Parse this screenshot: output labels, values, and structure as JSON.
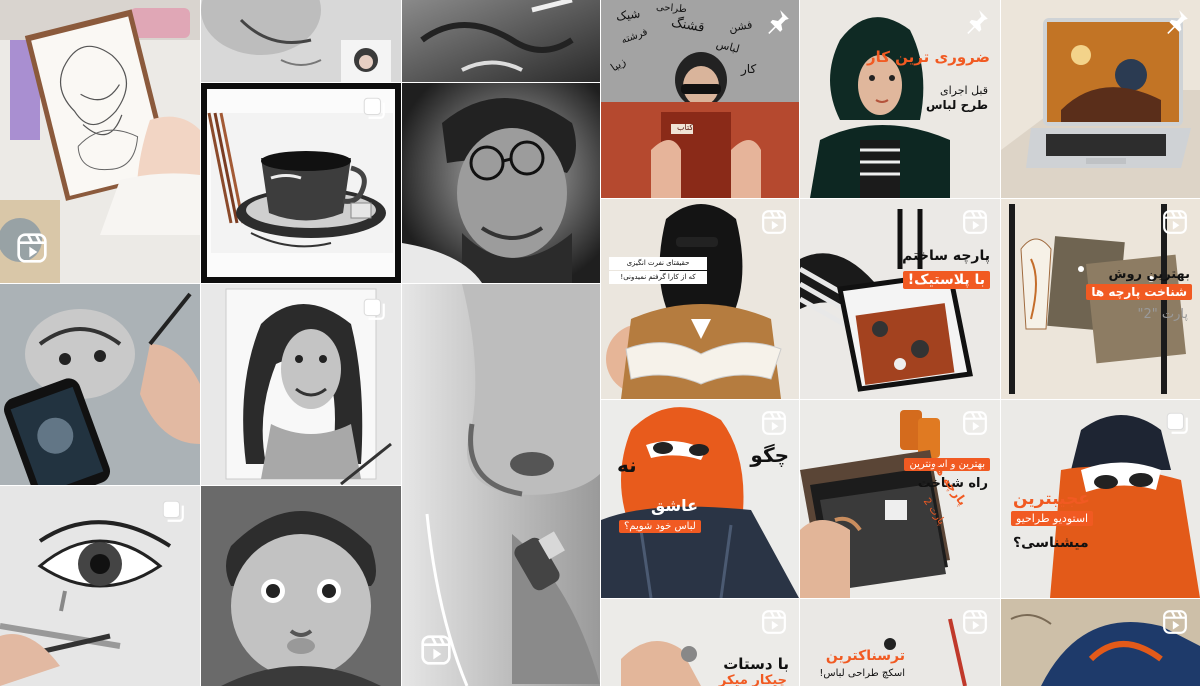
{
  "grid": {
    "tiles": [
      {
        "id": "sketching-desk",
        "type": "reel"
      },
      {
        "id": "woman-portrait-pencil",
        "type": "photo"
      },
      {
        "id": "old-man-pencil",
        "type": "photo"
      },
      {
        "id": "coffee-cup-drawing",
        "type": "carousel"
      },
      {
        "id": "man-glasses-drawing",
        "type": "photo"
      },
      {
        "id": "hand-drawing-phone",
        "type": "photo"
      },
      {
        "id": "smiling-woman-drawing",
        "type": "carousel"
      },
      {
        "id": "nose-closeup-drawing",
        "type": "reel"
      },
      {
        "id": "eye-drawing",
        "type": "carousel"
      },
      {
        "id": "baby-drawing",
        "type": "photo"
      },
      {
        "id": "calligraphy-girl",
        "type": "pinned"
      },
      {
        "id": "hijab-woman-post",
        "type": "pinned"
      },
      {
        "id": "laptop-post",
        "type": "pinned"
      },
      {
        "id": "niqab-book-post",
        "type": "reel"
      },
      {
        "id": "plastic-fabric-post",
        "type": "reel"
      },
      {
        "id": "fabric-recognition-post",
        "type": "reel"
      },
      {
        "id": "orange-scarf-post",
        "type": "reel"
      },
      {
        "id": "fabric-samples-post",
        "type": "reel"
      },
      {
        "id": "studio-post",
        "type": "carousel"
      },
      {
        "id": "hands-post",
        "type": "reel"
      },
      {
        "id": "scariest-post",
        "type": "reel"
      },
      {
        "id": "blue-hat-post",
        "type": "reel"
      }
    ]
  },
  "captions": {
    "hijab_line1": "ضروری ترین کار",
    "hijab_line2": "قبل اجرای",
    "hijab_line3": "طرح لباس",
    "niqab_line1": "حقیقتای نفرت انگیزی",
    "niqab_line2": "که از کارا گرفتم نمیدونی!",
    "plastic_line1": "پارچه ساختم",
    "plastic_line2": "با پلاستیک!",
    "fabric_line1": "بهترین روش",
    "fabric_line2": "شناخت پارچه ها",
    "fabric_line3": "پارت \"2\"",
    "scarf_line1": "چگو",
    "scarf_line2": "نه",
    "scarf_line3": "عاشق",
    "scarf_line4": "لباس خود شویم؟",
    "samples_line1": "بهترین و اسونترین",
    "samples_line2": "راه شناخت",
    "samples_line3": "پارچه ها",
    "samples_line4": "پارت 2",
    "studio_line1": "عجیبترین",
    "studio_line2": "استودیو طراحیو",
    "studio_line3": "میشناسی؟",
    "hands_line1": "با دستات",
    "hands_line2": "چیکار میکر",
    "scariest_line1": "ترسناکترین",
    "scariest_line2": "اسکچ طراحی لباس!",
    "book_label": "کتاب",
    "calligraphy_words": [
      "شیک",
      "قشنگ",
      "فرشته",
      "لباس",
      "زیبا",
      "کار",
      "طراحی",
      "فشن"
    ]
  },
  "colors": {
    "accent_orange": "#f15a22",
    "badge_white": "#ffffff"
  }
}
